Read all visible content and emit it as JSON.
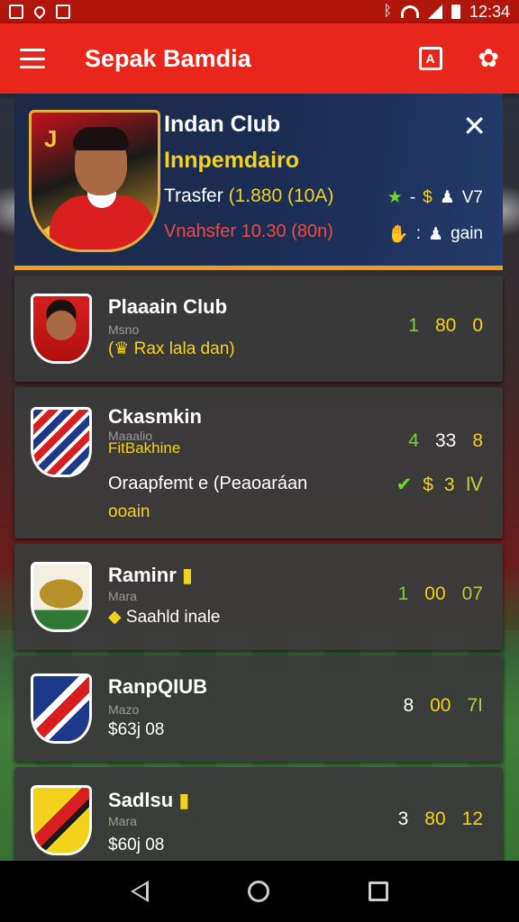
{
  "status_bar": {
    "time": "12:34"
  },
  "app_bar": {
    "title": "Sepak Bamdia",
    "bookmark_glyph": "A"
  },
  "featured": {
    "crest_letter": "J",
    "name": "Indan Club",
    "subtitle": "Innpemdairo",
    "transfer_label": "Trasfer",
    "transfer_value": "(1.880 (10A)",
    "stat1_a": "-",
    "stat1_b": "V7",
    "line2": "Vnahsfer 10.30 (80n)",
    "stat2_a": ":",
    "stat2_b": "gain",
    "close_glyph": "✕"
  },
  "clubs": [
    {
      "name": "Plaaain Club",
      "meta": "Msno",
      "extra": "(♛ Rax lala dan)",
      "stats": [
        "1",
        "80",
        "0"
      ]
    },
    {
      "name": "Ckasmkin",
      "meta": "Maaalio",
      "extra": "FitBakhine",
      "line2": "Oraapfemt e (Peaoaráan",
      "line3": "ooain",
      "stats": [
        "4",
        "33",
        "8"
      ],
      "stats2": [
        "✔",
        "$",
        "3",
        "Ⅳ"
      ]
    },
    {
      "name": "Raminr",
      "meta": "Mara",
      "extra": "Saahld inale",
      "stats": [
        "1",
        "00",
        "07"
      ]
    },
    {
      "name": "RanpQIUB",
      "meta": "Mazo",
      "extra": "$63j 08",
      "stats": [
        "8",
        "00",
        "7I"
      ]
    },
    {
      "name": "Sadlsu",
      "meta": "Mara",
      "extra": "$60j 08",
      "stats": [
        "3",
        "80",
        "12"
      ]
    }
  ]
}
